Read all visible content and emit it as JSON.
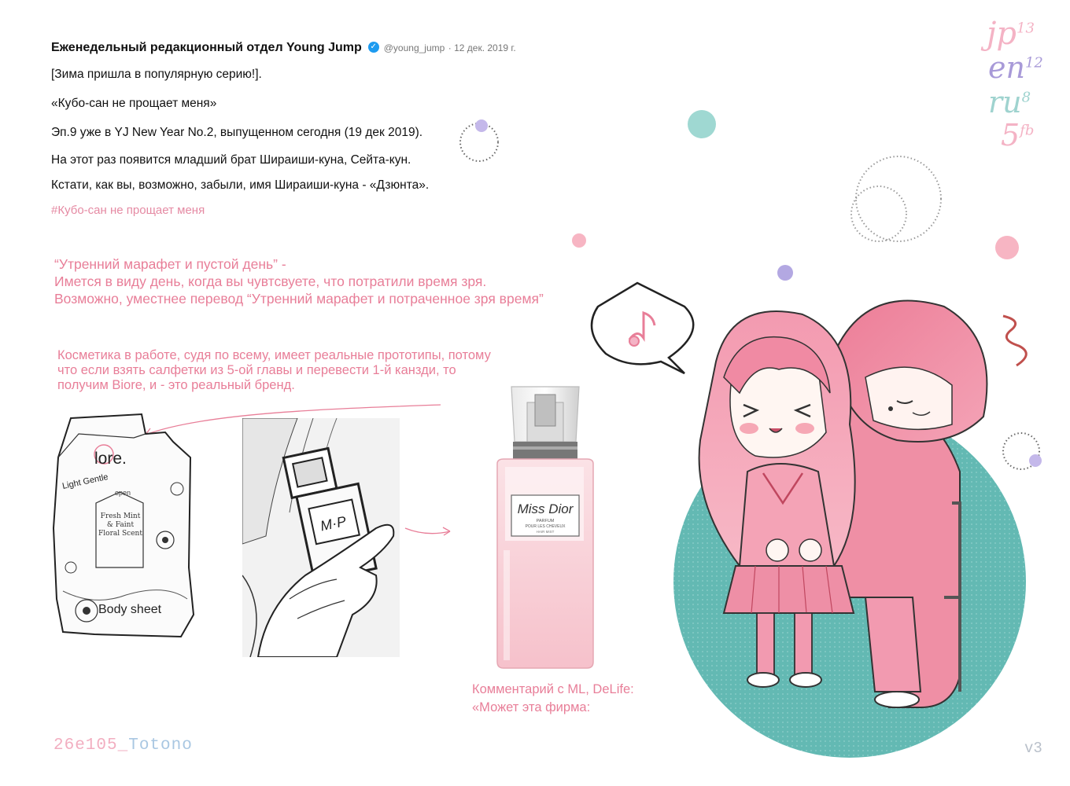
{
  "tweet": {
    "author": "Еженедельный редакционный отдел Young Jump",
    "handle": "@young_jump",
    "date": "· 12 дек. 2019 г.",
    "lines": [
      "[Зима пришла в популярную серию!].",
      "«Кубо-сан не прощает меня»",
      "Эп.9 уже в YJ New Year No.2, выпущенном сегодня (19 дек 2019).",
      "На этот раз появится младший брат Шираиши-куна, Сейта-кун.",
      "Кстати, как вы, возможно, забыли, имя Шираиши-куна - «Дзюнта»."
    ],
    "hashtag": "#Кубо-сан не прощает меня"
  },
  "notes": {
    "note1": [
      "“Утренний марафет и пустой день” -",
      "Имется в виду день, когда вы чувтсвуете, что потратили время зря.",
      "Возможно, уместнее перевод “Утренний марафет и потраченное зря время”"
    ],
    "note2": [
      "Косметика в работе, судя по всему, имеет реальные прототипы, потому",
      "что если взять салфетки из 5-ой главы и перевести 1-й канзди, то",
      "получим Biore, и - это реальный бренд."
    ]
  },
  "corner_tags": [
    {
      "lang": "jp",
      "num": "13",
      "color": "#f4b3c5"
    },
    {
      "lang": "en",
      "num": "12",
      "color": "#a89ad8"
    },
    {
      "lang": "ru",
      "num": "8",
      "color": "#9fd3cf"
    },
    {
      "lang": "5",
      "num": "fb",
      "color": "#f4b3c5"
    }
  ],
  "panels": {
    "wipes": {
      "brand": "lore.",
      "light_gentle": "Light Gentle",
      "open": "open",
      "fresh_mint": "Fresh Mint & Faint Floral Scent",
      "body_sheet": "Body sheet"
    },
    "perfume_small": {
      "label": "M·P"
    },
    "perfume": {
      "name": "Miss Dior",
      "line1": "PARFUM",
      "line2": "POUR LES CHEVEUX",
      "line3": "HAIR MIST"
    }
  },
  "comment": {
    "line1": "Комментарий с ML, DeLife:",
    "line2": "«Может эта фирма:"
  },
  "footer": {
    "signature_a": "26e105_",
    "signature_b": "Totono",
    "version": "v3"
  },
  "colors": {
    "accent_pink": "#e87e98",
    "teal": "#5fb8b4",
    "hair_pink": "#ef8fa5",
    "lavender": "#a89ad8"
  }
}
